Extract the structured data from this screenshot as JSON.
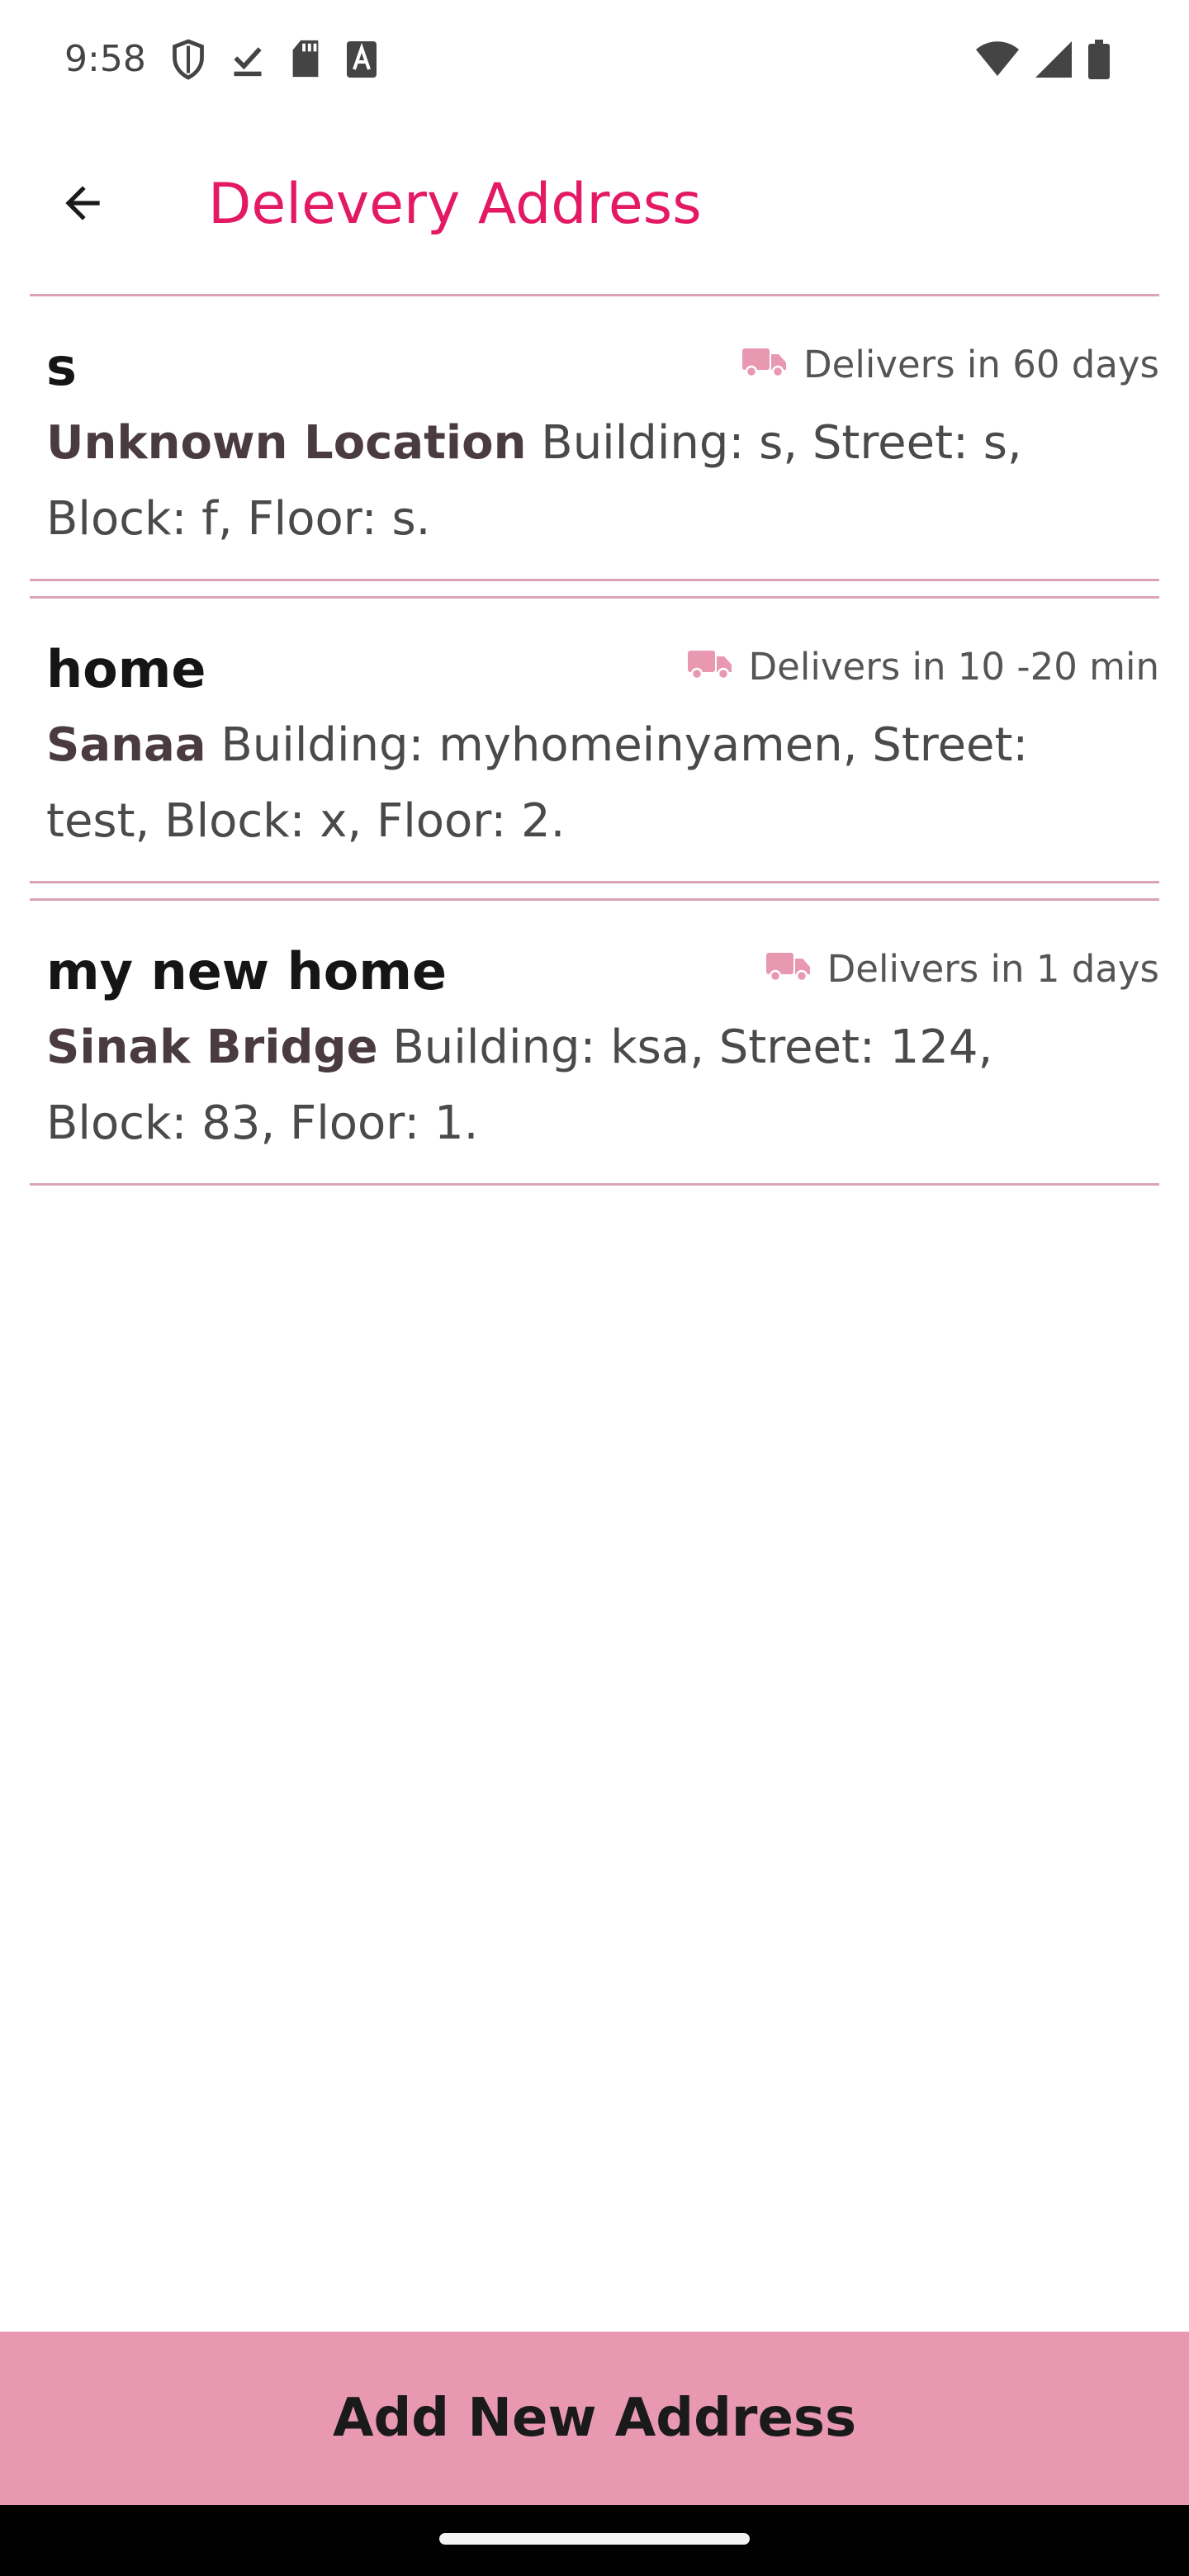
{
  "status_bar": {
    "time": "9:58",
    "icons": [
      "shield-icon",
      "download-done-icon",
      "sd-card-icon",
      "font-a-icon",
      "wifi-icon",
      "cell-signal-icon",
      "battery-icon"
    ]
  },
  "app_bar": {
    "title": "Delevery Address",
    "back_icon": "arrow-back-icon"
  },
  "addresses": [
    {
      "name": "s",
      "delivery": "Delivers in 60 days",
      "city": "Unknown Location",
      "details": " Building: s, Street: s, Block: f, Floor: s."
    },
    {
      "name": "home",
      "delivery": "Delivers in 10 -20 min",
      "city": "Sanaa",
      "details": " Building: myhomeinyamen, Street: test, Block: x, Floor: 2."
    },
    {
      "name": "my new home",
      "delivery": "Delivers in 1 days",
      "city": "Sinak Bridge",
      "details": " Building: ksa, Street: 124, Block: 83, Floor: 1."
    }
  ],
  "add_button": {
    "label": "Add New Address"
  },
  "colors": {
    "accent": "#e31a63",
    "divider": "#dca3b7",
    "button_bg": "#e899b1",
    "truck_icon": "#e899b1"
  }
}
